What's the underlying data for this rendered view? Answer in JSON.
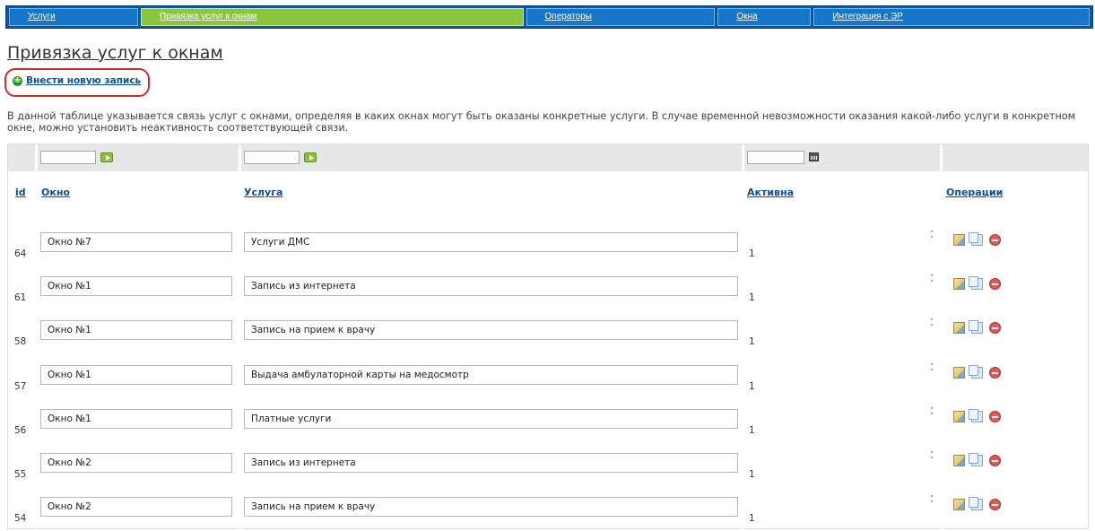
{
  "nav": {
    "items": [
      {
        "label": "Услуги"
      },
      {
        "label": "Привязка услуг к окнам"
      },
      {
        "label": "Операторы"
      },
      {
        "label": "Окна"
      },
      {
        "label": "Интеграция с ЭР"
      }
    ],
    "active_index": 1
  },
  "page": {
    "title": "Привязка услуг к окнам",
    "add_link": "Внести новую запись",
    "description": "В данной таблице указывается связь услуг с окнами, определяя в каких окнах могут быть оказаны конкретные услуги. В случае временной невозможности оказания какой-либо услуги в конкретном окне, можно установить неактивность соответствующей связи."
  },
  "icons": {
    "add": "plus-circle-icon",
    "filter_go": "arrow-right-icon",
    "date": "calendar-icon",
    "edit": "edit-icon",
    "copy": "copy-icon",
    "delete": "delete-icon"
  },
  "table": {
    "columns": {
      "id": "id",
      "window": "Окно",
      "service": "Услуга",
      "active": "Активна",
      "operations": "Операции"
    },
    "rows": [
      {
        "id": "64",
        "window": "Окно №7",
        "service": "Услуги ДМС",
        "active": "1"
      },
      {
        "id": "61",
        "window": "Окно №1",
        "service": "Запись из интернета",
        "active": "1"
      },
      {
        "id": "58",
        "window": "Окно №1",
        "service": "Запись на прием к врачу",
        "active": "1"
      },
      {
        "id": "57",
        "window": "Окно №1",
        "service": "Выдача амбулаторной карты на медосмотр",
        "active": "1"
      },
      {
        "id": "56",
        "window": "Окно №1",
        "service": "Платные услуги",
        "active": "1"
      },
      {
        "id": "55",
        "window": "Окно №2",
        "service": "Запись из интернета",
        "active": "1"
      },
      {
        "id": "54",
        "window": "Окно №2",
        "service": "Запись на прием к врачу",
        "active": "1"
      }
    ]
  }
}
